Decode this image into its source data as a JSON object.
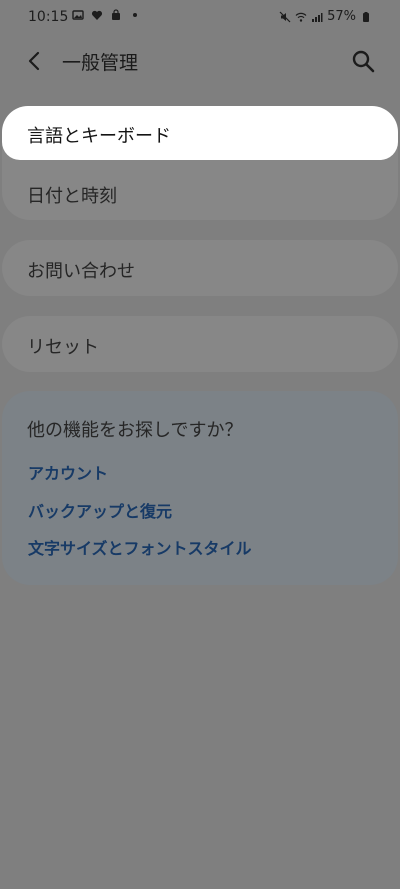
{
  "status_bar": {
    "time": "10:15",
    "battery": "57%"
  },
  "header": {
    "title": "一般管理",
    "icons": {
      "back": "back-arrow-icon",
      "search": "search-icon"
    }
  },
  "settings": {
    "items": [
      {
        "label": "言語とキーボード"
      },
      {
        "label": "日付と時刻"
      },
      {
        "label": "お問い合わせ"
      },
      {
        "label": "リセット"
      }
    ]
  },
  "looking_for": {
    "title": "他の機能をお探しですか？",
    "links": [
      {
        "label": "アカウント"
      },
      {
        "label": "バックアップと復元"
      },
      {
        "label": "文字サイズとフォントスタイル"
      }
    ]
  },
  "colors": {
    "dim_background": "#7f7f7f",
    "highlight": "#ffffff",
    "link": "#173a66"
  }
}
